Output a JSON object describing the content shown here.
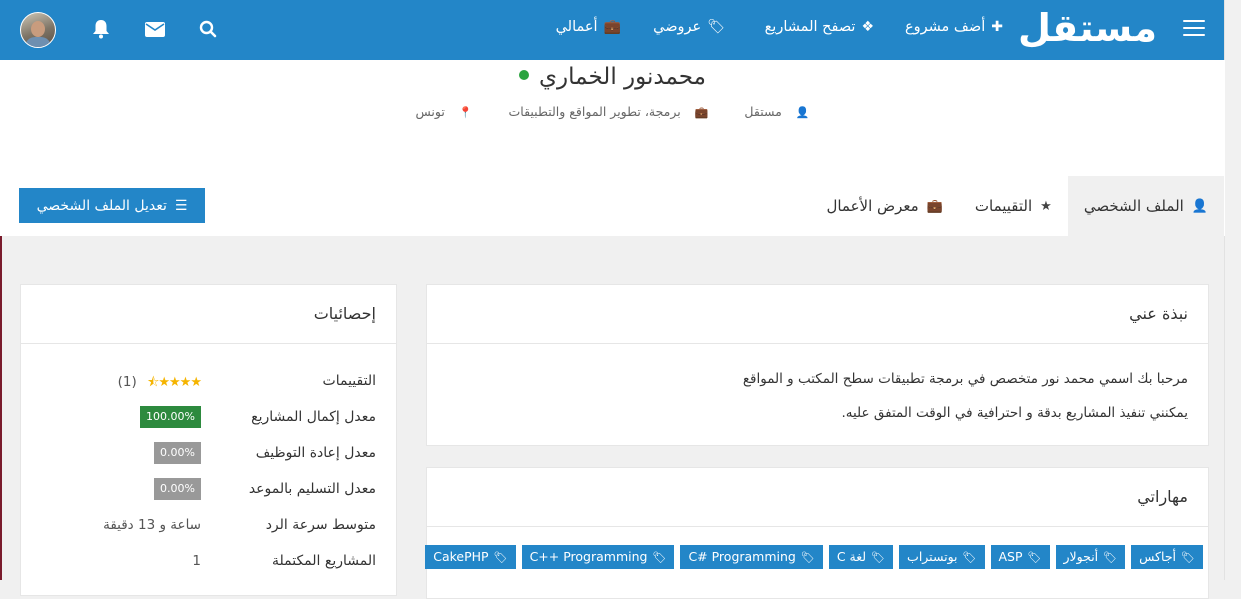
{
  "header": {
    "logo": "مستقل",
    "nav": [
      {
        "label": "أضف مشروع",
        "icon": "plus-icon"
      },
      {
        "label": "تصفح المشاريع",
        "icon": "cubes-icon"
      },
      {
        "label": "عروضي",
        "icon": "ticket-icon"
      },
      {
        "label": "أعمالي",
        "icon": "briefcase-icon"
      }
    ]
  },
  "profile": {
    "name": "محمدنور الخماري",
    "role": "مستقل",
    "specialty": "برمجة، تطوير المواقع والتطبيقات",
    "location": "تونس"
  },
  "tabs": [
    {
      "label": "الملف الشخصي",
      "icon": "user-icon",
      "active": true
    },
    {
      "label": "التقييمات",
      "icon": "star-icon",
      "active": false
    },
    {
      "label": "معرض الأعمال",
      "icon": "briefcase-icon",
      "active": false
    }
  ],
  "edit_button": "تعديل الملف الشخصي",
  "about": {
    "title": "نبذة عني",
    "lines": [
      "مرحبا بك اسمي محمد نور متخصص في برمجة تطبيقات سطح المكتب و المواقع",
      "يمكنني تنفيذ المشاريع بدقة و احترافية في الوقت المتفق عليه."
    ]
  },
  "skills": {
    "title": "مهاراتي",
    "items": [
      "أجاكس",
      "أنجولار",
      "ASP",
      "بوتستراب",
      "لغة C",
      "C# Programming",
      "C++ Programming",
      "CakePHP"
    ]
  },
  "stats": {
    "title": "إحصائيات",
    "rows": [
      {
        "label": "التقييمات",
        "value": "(1)",
        "stars": 4.5,
        "type": "rating"
      },
      {
        "label": "معدل إكمال المشاريع",
        "value": "100.00%",
        "type": "badge-green"
      },
      {
        "label": "معدل إعادة التوظيف",
        "value": "0.00%",
        "type": "badge-gray"
      },
      {
        "label": "معدل التسليم بالموعد",
        "value": "0.00%",
        "type": "badge-gray"
      },
      {
        "label": "متوسط سرعة الرد",
        "value": "ساعة و 13 دقيقة",
        "type": "text"
      },
      {
        "label": "المشاريع المكتملة",
        "value": "1",
        "type": "text"
      }
    ]
  },
  "colors": {
    "primary": "#2386c8",
    "online": "#2aa33f",
    "success": "#2d8a3e",
    "muted": "#999999"
  }
}
